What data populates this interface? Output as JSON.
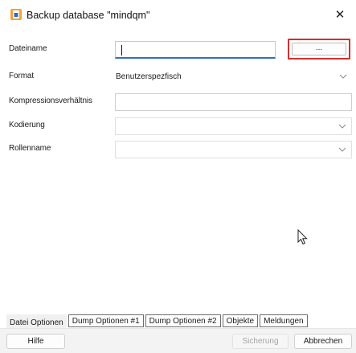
{
  "window": {
    "title": "Backup database \"mindqm\"",
    "close_glyph": "✕",
    "app_icon": "backup-database-icon"
  },
  "form": {
    "filename": {
      "label": "Dateiname",
      "value": "",
      "browse_label": "..."
    },
    "format": {
      "label": "Format",
      "value": "Benutzerspezfisch"
    },
    "compression": {
      "label": "Kompressionsverhältnis",
      "value": ""
    },
    "encoding": {
      "label": "Kodierung",
      "value": ""
    },
    "rolename": {
      "label": "Rollenname",
      "value": ""
    }
  },
  "tabs": [
    {
      "label": "Datei Optionen",
      "selected": true
    },
    {
      "label": "Dump Optionen #1",
      "selected": false
    },
    {
      "label": "Dump Optionen #2",
      "selected": false
    },
    {
      "label": "Objekte",
      "selected": false
    },
    {
      "label": "Meldungen",
      "selected": false
    }
  ],
  "footer": {
    "help_label": "Hilfe",
    "backup_label": "Sicherung",
    "backup_enabled": false,
    "cancel_label": "Abbrechen"
  },
  "colors": {
    "highlight_box": "#d42f2f",
    "focus_underline": "#3570b8"
  }
}
